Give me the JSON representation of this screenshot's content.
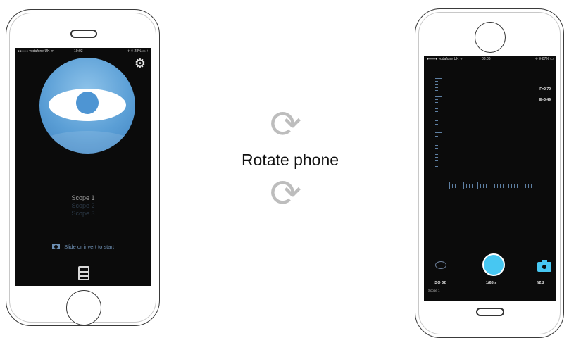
{
  "left_phone": {
    "status": {
      "carrier": "●●●●● vodafone UK ᯤ",
      "time": "10:03",
      "battery": "✈ ⌾ 28% ▭ +"
    },
    "scopes": [
      "Scope 1",
      "Scope 2",
      "Scope 3"
    ],
    "start_hint": "Slide or invert to start",
    "icons": {
      "settings": "gear-icon",
      "camera": "camera-icon",
      "film": "film-icon"
    }
  },
  "middle": {
    "label": "Rotate phone",
    "icon_glyph_top": "⟳",
    "icon_glyph_bottom": "⟳"
  },
  "right_phone": {
    "status": {
      "carrier": "●●●●● vodafone UK ᯤ",
      "time": "08:06",
      "battery": "✈ ⌾ 87% ▭"
    },
    "readouts": {
      "f": "F=0.70",
      "e": "E=0.49"
    },
    "iso": "ISO 32",
    "shutter_speed": "1/65 s",
    "aperture": "f/2.2",
    "scope": "Scope 1"
  },
  "colors": {
    "accent": "#47c7f2",
    "logo": "#5b9fd6",
    "screen": "#0b0b0b"
  }
}
